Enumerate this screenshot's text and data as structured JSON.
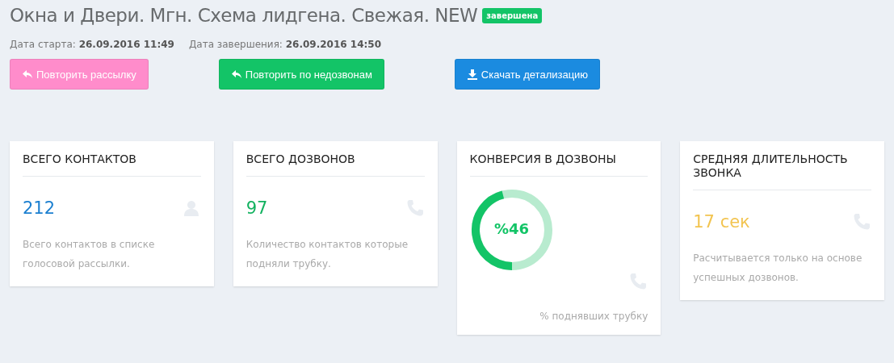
{
  "header": {
    "title": "Окна и Двери. Мгн. Схема лидгена. Свежая. NEW",
    "status_badge": "завершена"
  },
  "dates": [
    {
      "label": "Дата старта:",
      "value": "26.09.2016 11:49"
    },
    {
      "label": "Дата завершения:",
      "value": "26.09.2016 14:50"
    }
  ],
  "buttons": [
    {
      "label": "Повторить рассылку",
      "kind": "reply",
      "color": "#ff8ccb"
    },
    {
      "label": "Повторить по недозвонам",
      "kind": "reply",
      "color": "#13c467"
    },
    {
      "label": "Скачать детализацию",
      "kind": "download",
      "color": "#1b8be0"
    }
  ],
  "cards": [
    {
      "kind": "stat",
      "title": "ВСЕГО КОНТАКТОВ",
      "value": "212",
      "color": "#1b7fd0",
      "description": "Всего контактов в списке голосовой рассылки."
    },
    {
      "kind": "stat",
      "title": "ВСЕГО ДОЗВОНОВ",
      "value": "97",
      "color": "#13b260",
      "description": "Количество контактов которые подняли трубку."
    },
    {
      "kind": "donut",
      "title": "КОНВЕРСИЯ В ДОЗВОНЫ",
      "value": "%46",
      "level": 0.46,
      "color": "#13c467",
      "description": "% поднявших трубку"
    },
    {
      "kind": "stat",
      "title": "СРЕДНЯЯ ДЛИТЕЛЬНОСТЬ ЗВОНКА",
      "value": "17 сек",
      "color": "#f2c450",
      "description": "Расчитывается только на основе успешных дозвонов."
    }
  ]
}
